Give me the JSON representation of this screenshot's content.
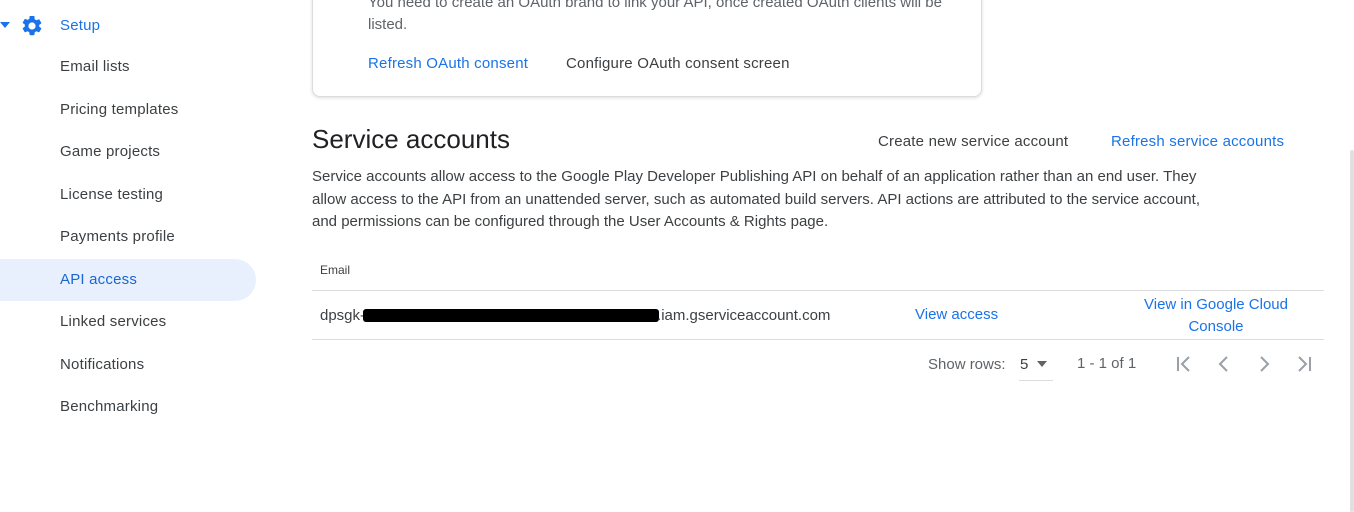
{
  "sidebar": {
    "setup_label": "Setup",
    "items": [
      {
        "label": "Email lists"
      },
      {
        "label": "Pricing templates"
      },
      {
        "label": "Game projects"
      },
      {
        "label": "License testing"
      },
      {
        "label": "Payments profile"
      },
      {
        "label": "API access",
        "active": true
      },
      {
        "label": "Linked services"
      },
      {
        "label": "Notifications"
      },
      {
        "label": "Benchmarking"
      }
    ]
  },
  "oauth": {
    "text": "You need to create an OAuth brand to link your API, once created OAuth clients will be listed.",
    "refresh_label": "Refresh OAuth consent",
    "configure_label": "Configure OAuth consent screen"
  },
  "service_accounts": {
    "title": "Service accounts",
    "create_label": "Create new service account",
    "refresh_label": "Refresh service accounts",
    "description": "Service accounts allow access to the Google Play Developer Publishing API on behalf of an application rather than an end user. They allow access to the API from an unattended server, such as automated build servers. API actions are attributed to the service account, and permissions can be configured through the User Accounts & Rights page.",
    "table": {
      "columns": [
        "Email"
      ],
      "rows": [
        {
          "email_prefix": "dpsgk-",
          "email_suffix": ".iam.gserviceaccount.com",
          "view_access_label": "View access",
          "view_cloud_label": "View in Google Cloud Console"
        }
      ]
    },
    "pagination": {
      "show_rows_label": "Show rows:",
      "rows_per_page": "5",
      "range": "1 - 1 of 1"
    }
  },
  "colors": {
    "accent": "#1a73e8",
    "active_bg": "#e8f0fe",
    "divider": "#dadce0",
    "redaction": "#000000"
  },
  "icons": [
    "caret-down-icon",
    "gear-icon",
    "first-page-icon",
    "prev-page-icon",
    "next-page-icon",
    "last-page-icon"
  ]
}
